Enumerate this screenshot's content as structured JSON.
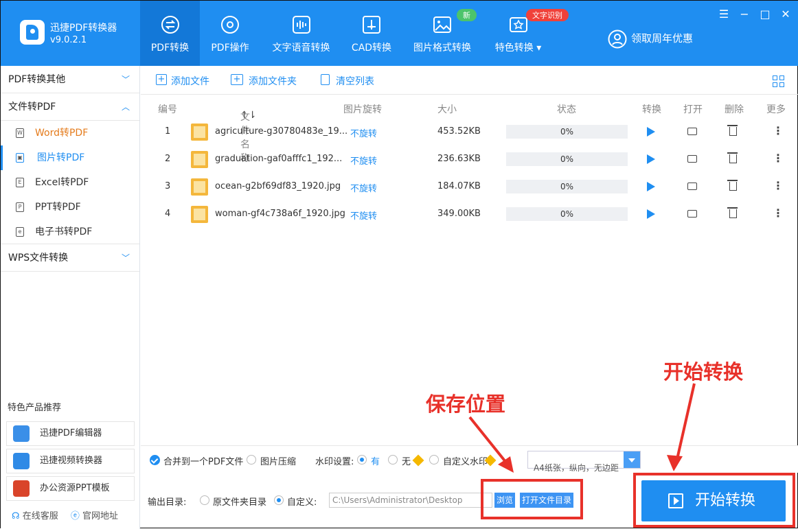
{
  "app": {
    "name": "迅捷PDF转换器",
    "version": "v9.0.2.1"
  },
  "nav": [
    {
      "label": "PDF转换",
      "icon": "pdf-convert-icon"
    },
    {
      "label": "PDF操作",
      "icon": "gear-doc-icon"
    },
    {
      "label": "文字语音转换",
      "icon": "audio-wave-icon"
    },
    {
      "label": "CAD转换",
      "icon": "cad-icon"
    },
    {
      "label": "图片格式转换",
      "icon": "image-icon",
      "badge": "新"
    },
    {
      "label": "特色转换",
      "icon": "star-icon",
      "badge": "文字识别"
    }
  ],
  "promo": "领取周年优惠",
  "sidebar": {
    "sections": [
      {
        "label": "PDF转换其他"
      },
      {
        "label": "文件转PDF"
      },
      {
        "label": "WPS文件转换"
      }
    ],
    "items": [
      {
        "label": "Word转PDF",
        "icon": "W"
      },
      {
        "label": "图片转PDF",
        "icon": "▣"
      },
      {
        "label": "Excel转PDF",
        "icon": "E"
      },
      {
        "label": "PPT转PDF",
        "icon": "P"
      },
      {
        "label": "电子书转PDF",
        "icon": "e"
      }
    ],
    "products_title": "特色产品推荐",
    "products": [
      {
        "label": "迅捷PDF编辑器",
        "color": "#3a8fe8"
      },
      {
        "label": "迅捷视频转换器",
        "color": "#2f8ae6"
      },
      {
        "label": "办公资源PPT模板",
        "color": "#d9442a"
      }
    ],
    "footer": {
      "service": "在线客服",
      "site": "官网地址"
    }
  },
  "toolbar": {
    "add_file": "添加文件",
    "add_folder": "添加文件夹",
    "clear": "清空列表"
  },
  "table": {
    "headers": {
      "no": "编号",
      "name": "文件名称",
      "rotate": "图片旋转",
      "size": "大小",
      "status": "状态",
      "convert": "转换",
      "open": "打开",
      "delete": "删除",
      "more": "更多"
    },
    "rows": [
      {
        "no": "1",
        "name": "agriculture-g30780483e_19...",
        "rotate": "不旋转",
        "size": "453.52KB",
        "progress": "0%"
      },
      {
        "no": "2",
        "name": "graduation-gaf0afffc1_192...",
        "rotate": "不旋转",
        "size": "236.63KB",
        "progress": "0%"
      },
      {
        "no": "3",
        "name": "ocean-g2bf69df83_1920.jpg",
        "rotate": "不旋转",
        "size": "184.07KB",
        "progress": "0%"
      },
      {
        "no": "4",
        "name": "woman-gf4c738a6f_1920.jpg",
        "rotate": "不旋转",
        "size": "349.00KB",
        "progress": "0%"
      }
    ]
  },
  "options": {
    "merge": "合并到一个PDF文件",
    "compress": "图片压缩",
    "watermark_label": "水印设置:",
    "wm_yes": "有",
    "wm_no": "无",
    "wm_custom": "自定义水印",
    "page_setting": "A4纸张，纵向，无边距"
  },
  "output": {
    "label": "输出目录:",
    "source_dir": "原文件夹目录",
    "custom": "自定义:",
    "path": "C:\\Users\\Administrator\\Desktop",
    "browse": "浏览",
    "open_dir": "打开文件目录"
  },
  "start": "开始转换",
  "annotations": {
    "save_location": "保存位置",
    "start": "开始转换"
  },
  "colors": {
    "primary": "#1f8ef1",
    "annotation": "#e8312a"
  }
}
